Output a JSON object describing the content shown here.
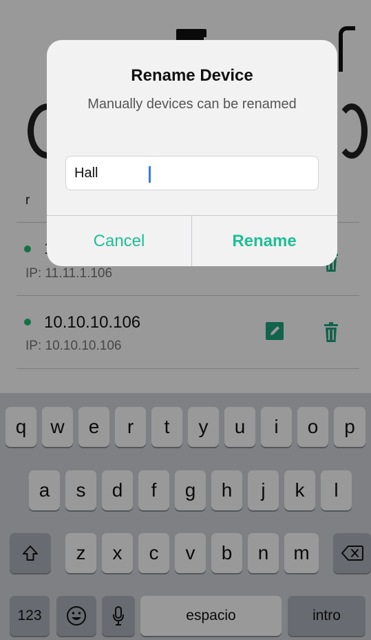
{
  "devices": [
    {
      "name": "1",
      "ip": "IP: 11.11.1.106",
      "status_color": "#1fbf73"
    },
    {
      "name": "10.10.10.106",
      "ip": "IP: 10.10.10.106",
      "status_color": "#1fbf73"
    }
  ],
  "section_hint": "r",
  "dialog": {
    "title": "Rename Device",
    "message": "Manually devices can be renamed",
    "input_value": "Hall",
    "cancel_label": "Cancel",
    "confirm_label": "Rename"
  },
  "keyboard": {
    "row1": [
      "q",
      "w",
      "e",
      "r",
      "t",
      "y",
      "u",
      "i",
      "o",
      "p"
    ],
    "row2": [
      "a",
      "s",
      "d",
      "f",
      "g",
      "h",
      "j",
      "k",
      "l"
    ],
    "row3": [
      "z",
      "x",
      "c",
      "v",
      "b",
      "n",
      "m"
    ],
    "numbers_label": "123",
    "space_label": "espacio",
    "return_label": "intro"
  },
  "colors": {
    "accent": "#1fbf95",
    "icon_green": "#1fa67e",
    "online_dot": "#1fbf73"
  },
  "icons": {
    "edit": "edit-icon",
    "delete": "trash-icon",
    "shift": "shift-icon",
    "backspace": "backspace-icon",
    "emoji": "emoji-icon",
    "mic": "microphone-icon"
  }
}
